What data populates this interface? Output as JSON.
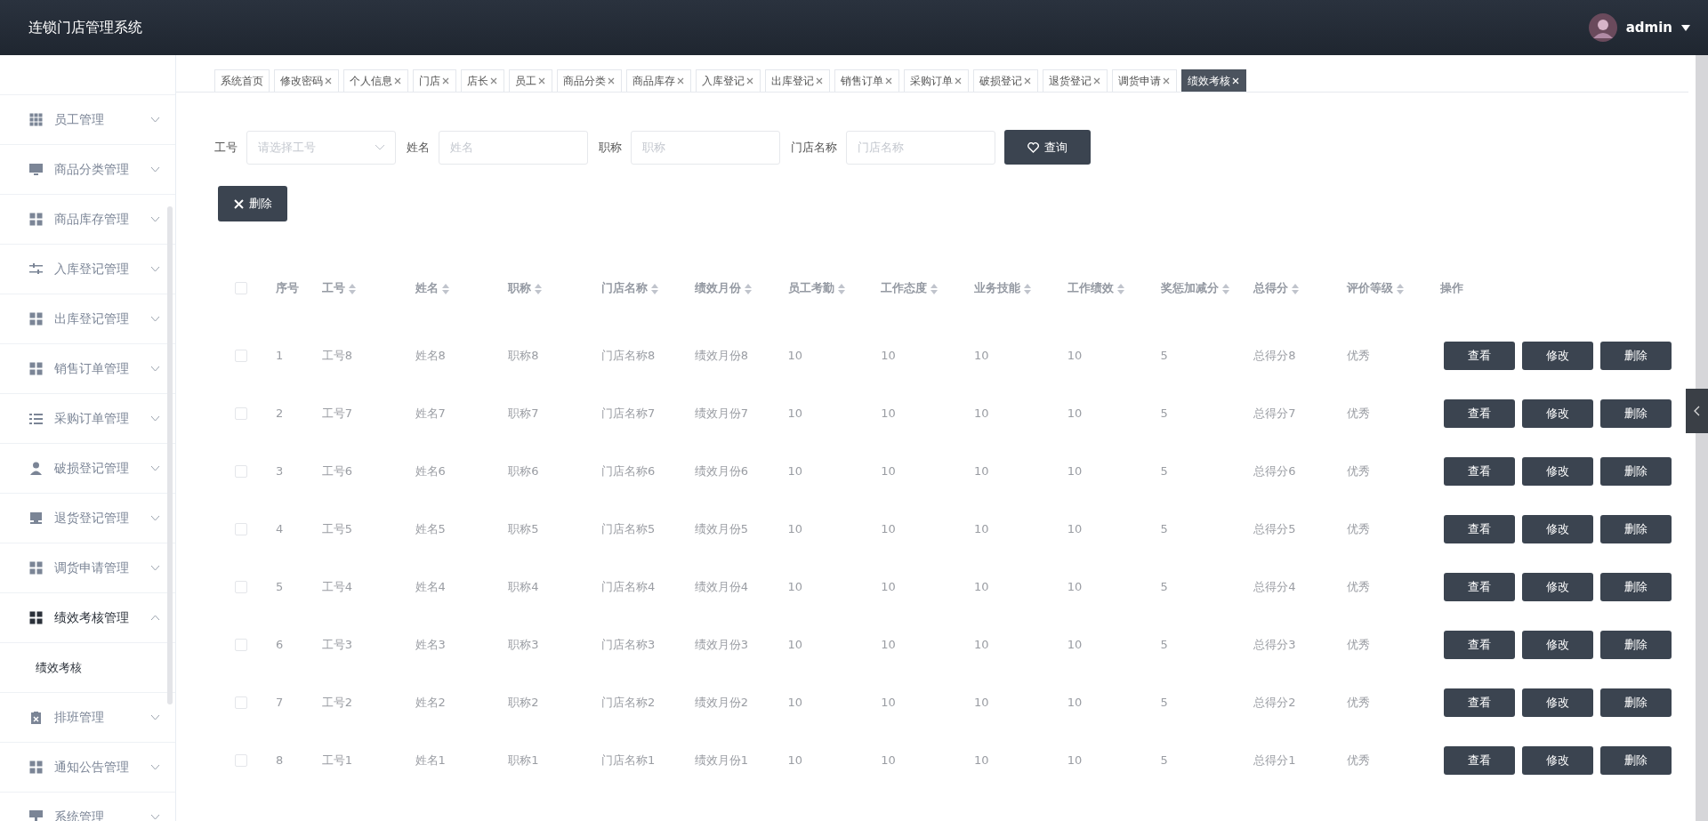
{
  "header": {
    "title": "连锁门店管理系统",
    "user": "admin"
  },
  "sidebar": {
    "items": [
      {
        "label": "员工管理",
        "expanded": false,
        "selected": false
      },
      {
        "label": "商品分类管理",
        "expanded": false,
        "selected": false
      },
      {
        "label": "商品库存管理",
        "expanded": false,
        "selected": false
      },
      {
        "label": "入库登记管理",
        "expanded": false,
        "selected": false
      },
      {
        "label": "出库登记管理",
        "expanded": false,
        "selected": false
      },
      {
        "label": "销售订单管理",
        "expanded": false,
        "selected": false
      },
      {
        "label": "采购订单管理",
        "expanded": false,
        "selected": false
      },
      {
        "label": "破损登记管理",
        "expanded": false,
        "selected": false
      },
      {
        "label": "退货登记管理",
        "expanded": false,
        "selected": false
      },
      {
        "label": "调货申请管理",
        "expanded": false,
        "selected": false
      },
      {
        "label": "绩效考核管理",
        "expanded": true,
        "selected": true,
        "children": [
          {
            "label": "绩效考核",
            "selected": true
          }
        ]
      },
      {
        "label": "排班管理",
        "expanded": false,
        "selected": false
      },
      {
        "label": "通知公告管理",
        "expanded": false,
        "selected": false
      },
      {
        "label": "系统管理",
        "expanded": false,
        "selected": false
      }
    ]
  },
  "tabs": [
    {
      "label": "系统首页",
      "closable": false,
      "selected": false
    },
    {
      "label": "修改密码",
      "closable": true,
      "selected": false
    },
    {
      "label": "个人信息",
      "closable": true,
      "selected": false
    },
    {
      "label": "门店",
      "closable": true,
      "selected": false
    },
    {
      "label": "店长",
      "closable": true,
      "selected": false
    },
    {
      "label": "员工",
      "closable": true,
      "selected": false
    },
    {
      "label": "商品分类",
      "closable": true,
      "selected": false
    },
    {
      "label": "商品库存",
      "closable": true,
      "selected": false
    },
    {
      "label": "入库登记",
      "closable": true,
      "selected": false
    },
    {
      "label": "出库登记",
      "closable": true,
      "selected": false
    },
    {
      "label": "销售订单",
      "closable": true,
      "selected": false
    },
    {
      "label": "采购订单",
      "closable": true,
      "selected": false
    },
    {
      "label": "破损登记",
      "closable": true,
      "selected": false
    },
    {
      "label": "退货登记",
      "closable": true,
      "selected": false
    },
    {
      "label": "调货申请",
      "closable": true,
      "selected": false
    },
    {
      "label": "绩效考核",
      "closable": true,
      "selected": true
    }
  ],
  "filters": [
    {
      "kind": "select",
      "label": "工号",
      "placeholder": "请选择工号"
    },
    {
      "kind": "input",
      "label": "姓名",
      "placeholder": "姓名"
    },
    {
      "kind": "input",
      "label": "职称",
      "placeholder": "职称"
    },
    {
      "kind": "input",
      "label": "门店名称",
      "placeholder": "门店名称"
    }
  ],
  "search_button": "查询",
  "delete_button": "删除",
  "table": {
    "all_checked": false,
    "columns": [
      {
        "label": "序号",
        "sortable": false
      },
      {
        "label": "工号",
        "sortable": true
      },
      {
        "label": "姓名",
        "sortable": true
      },
      {
        "label": "职称",
        "sortable": true
      },
      {
        "label": "门店名称",
        "sortable": true
      },
      {
        "label": "绩效月份",
        "sortable": true
      },
      {
        "label": "员工考勤",
        "sortable": true
      },
      {
        "label": "工作态度",
        "sortable": true
      },
      {
        "label": "业务技能",
        "sortable": true
      },
      {
        "label": "工作绩效",
        "sortable": true
      },
      {
        "label": "奖惩加减分",
        "sortable": true
      },
      {
        "label": "总得分",
        "sortable": true
      },
      {
        "label": "评价等级",
        "sortable": true
      },
      {
        "label": "操作",
        "sortable": false
      }
    ],
    "rows": [
      {
        "checked": false,
        "cells": [
          "1",
          "工号8",
          "姓名8",
          "职称8",
          "门店名称8",
          "绩效月份8",
          "10",
          "10",
          "10",
          "10",
          "5",
          "总得分8",
          "优秀"
        ],
        "actions": [
          "查看",
          "修改",
          "删除"
        ]
      },
      {
        "checked": false,
        "cells": [
          "2",
          "工号7",
          "姓名7",
          "职称7",
          "门店名称7",
          "绩效月份7",
          "10",
          "10",
          "10",
          "10",
          "5",
          "总得分7",
          "优秀"
        ],
        "actions": [
          "查看",
          "修改",
          "删除"
        ]
      },
      {
        "checked": false,
        "cells": [
          "3",
          "工号6",
          "姓名6",
          "职称6",
          "门店名称6",
          "绩效月份6",
          "10",
          "10",
          "10",
          "10",
          "5",
          "总得分6",
          "优秀"
        ],
        "actions": [
          "查看",
          "修改",
          "删除"
        ]
      },
      {
        "checked": false,
        "cells": [
          "4",
          "工号5",
          "姓名5",
          "职称5",
          "门店名称5",
          "绩效月份5",
          "10",
          "10",
          "10",
          "10",
          "5",
          "总得分5",
          "优秀"
        ],
        "actions": [
          "查看",
          "修改",
          "删除"
        ]
      },
      {
        "checked": false,
        "cells": [
          "5",
          "工号4",
          "姓名4",
          "职称4",
          "门店名称4",
          "绩效月份4",
          "10",
          "10",
          "10",
          "10",
          "5",
          "总得分4",
          "优秀"
        ],
        "actions": [
          "查看",
          "修改",
          "删除"
        ]
      },
      {
        "checked": false,
        "cells": [
          "6",
          "工号3",
          "姓名3",
          "职称3",
          "门店名称3",
          "绩效月份3",
          "10",
          "10",
          "10",
          "10",
          "5",
          "总得分3",
          "优秀"
        ],
        "actions": [
          "查看",
          "修改",
          "删除"
        ]
      },
      {
        "checked": false,
        "cells": [
          "7",
          "工号2",
          "姓名2",
          "职称2",
          "门店名称2",
          "绩效月份2",
          "10",
          "10",
          "10",
          "10",
          "5",
          "总得分2",
          "优秀"
        ],
        "actions": [
          "查看",
          "修改",
          "删除"
        ]
      },
      {
        "checked": false,
        "cells": [
          "8",
          "工号1",
          "姓名1",
          "职称1",
          "门店名称1",
          "绩效月份1",
          "10",
          "10",
          "10",
          "10",
          "5",
          "总得分1",
          "优秀"
        ],
        "actions": [
          "查看",
          "修改",
          "删除"
        ]
      }
    ]
  }
}
